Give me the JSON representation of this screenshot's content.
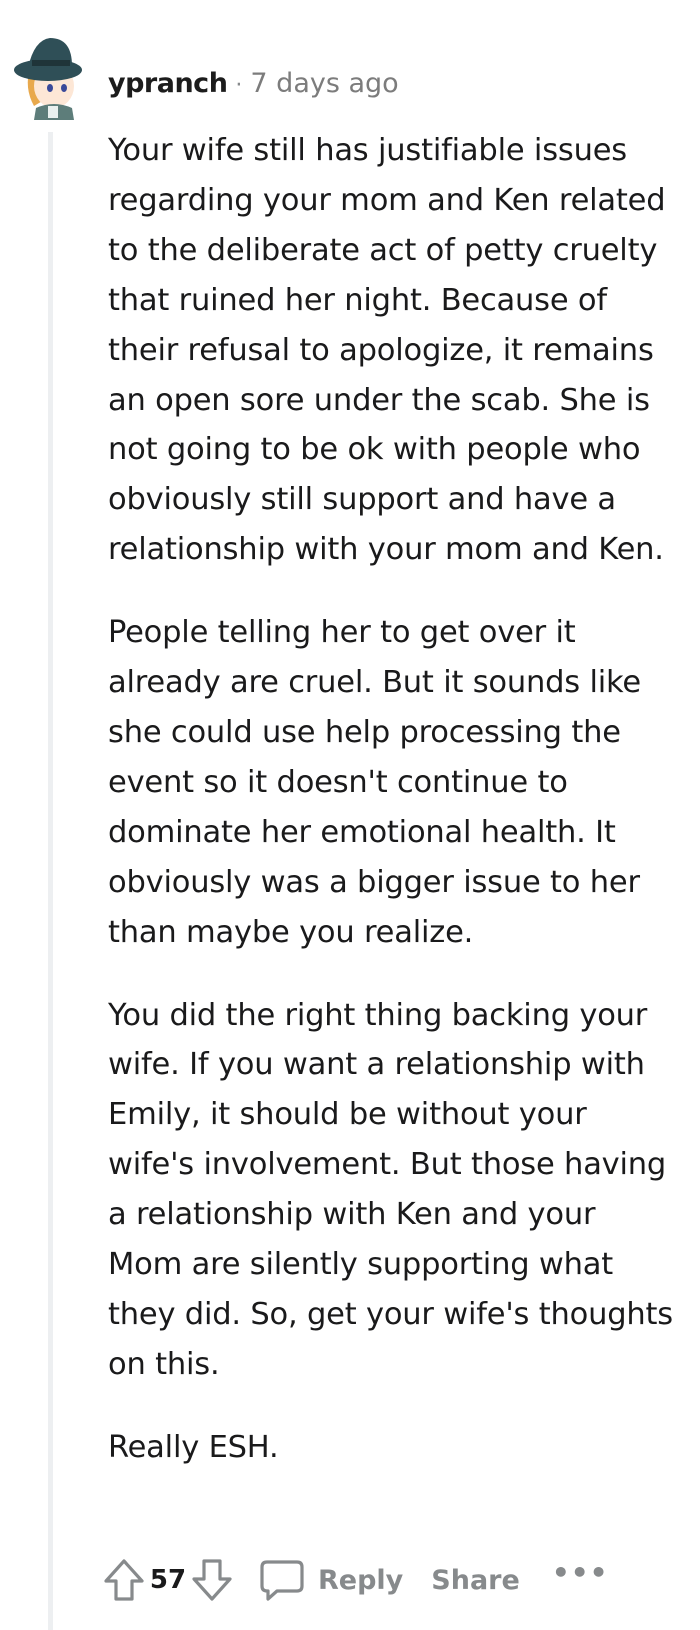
{
  "comment": {
    "username": "ypranch",
    "separator": "·",
    "timestamp": "7 days ago",
    "paragraphs": [
      "Your wife still has justifiable issues regarding your mom and Ken related to the deliberate act of petty cruelty that ruined her night. Because of their refusal to apologize, it remains an open sore under the scab. She is not going to be ok with people who obviously still support and have a relationship with your mom and Ken.",
      "People telling her to get over it already are cruel. But it sounds like she could use help processing the event so it doesn't continue to dominate her emotional health. It obviously was a bigger issue to her than maybe you realize.",
      "You did the right thing backing your wife. If you want a relationship with Emily, it should be without your wife's involvement. But those having a relationship with Ken and your Mom are silently supporting what they did. So, get your wife's thoughts on this.",
      "Really ESH."
    ]
  },
  "actions": {
    "upvote_icon": "upvote-arrow-icon",
    "score": "57",
    "downvote_icon": "downvote-arrow-icon",
    "comment_icon": "speech-bubble-icon",
    "reply_label": "Reply",
    "share_label": "Share",
    "more_label": "•••"
  },
  "colors": {
    "text": "#1a1a1b",
    "muted": "#878a8c",
    "thread_line": "#edeff1"
  }
}
